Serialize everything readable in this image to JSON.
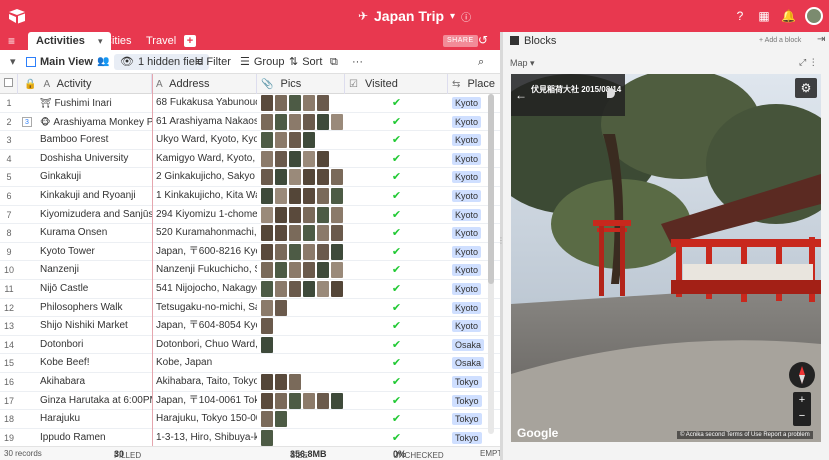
{
  "app": {
    "title": "Japan Trip",
    "share_label": "SHARE"
  },
  "tabs": [
    {
      "label": "Activities"
    },
    {
      "label": "Cities"
    },
    {
      "label": "Travel"
    }
  ],
  "toolbar": {
    "view_name": "Main View",
    "hidden_fields": "1 hidden field",
    "filter": "Filter",
    "group": "Group",
    "sort": "Sort"
  },
  "columns": [
    {
      "label": "Activity",
      "icon": "text-icon"
    },
    {
      "label": "Address",
      "icon": "text-icon"
    },
    {
      "label": "Pics",
      "icon": "attachment-icon"
    },
    {
      "label": "Visited",
      "icon": "checkbox-icon"
    },
    {
      "label": "Place",
      "icon": "link-icon"
    }
  ],
  "rows": [
    {
      "num": "1",
      "activity": "Fushimi Inari",
      "icon": "⛩",
      "address": "68 Fukakusa Yabunouchi...",
      "pics": 5,
      "visited": true,
      "place": "Kyoto"
    },
    {
      "num": "2",
      "activity": "Arashiyama Monkey Park",
      "icon": "🐵",
      "address": "61 Arashiyama Nakaoshit...",
      "pics": 6,
      "visited": true,
      "place": "Kyoto",
      "expand": "3"
    },
    {
      "num": "3",
      "activity": "Bamboo Forest",
      "icon": "",
      "address": "Ukyo Ward, Kyoto, Kyoto...",
      "pics": 4,
      "visited": true,
      "place": "Kyoto"
    },
    {
      "num": "4",
      "activity": "Doshisha University",
      "icon": "",
      "address": "Kamigyo Ward, Kyoto, K...",
      "pics": 5,
      "visited": true,
      "place": "Kyoto"
    },
    {
      "num": "5",
      "activity": "Ginkakuji",
      "icon": "",
      "address": "2 Ginkakujicho, Sakyo W...",
      "pics": 6,
      "visited": true,
      "place": "Kyoto"
    },
    {
      "num": "6",
      "activity": "Kinkakuji and Ryoanji",
      "icon": "",
      "address": "1 Kinkakujicho, Kita Ward...",
      "pics": 6,
      "visited": true,
      "place": "Kyoto"
    },
    {
      "num": "7",
      "activity": "Kiyomizudera and Sanjūsan...",
      "icon": "",
      "address": "294 Kiyomizu 1-chome, ...",
      "pics": 6,
      "visited": true,
      "place": "Kyoto"
    },
    {
      "num": "8",
      "activity": "Kurama Onsen",
      "icon": "",
      "address": "520 Kuramahonmachi, Sa...",
      "pics": 6,
      "visited": true,
      "place": "Kyoto"
    },
    {
      "num": "9",
      "activity": "Kyoto Tower",
      "icon": "",
      "address": "Japan, 〒600-8216 Kyoto...",
      "pics": 6,
      "visited": true,
      "place": "Kyoto"
    },
    {
      "num": "10",
      "activity": "Nanzenji",
      "icon": "",
      "address": "Nanzenji Fukuchicho, Sa...",
      "pics": 6,
      "visited": true,
      "place": "Kyoto"
    },
    {
      "num": "11",
      "activity": "Nijō Castle",
      "icon": "",
      "address": "541 Nijojocho, Nakagyo ...",
      "pics": 6,
      "visited": true,
      "place": "Kyoto"
    },
    {
      "num": "12",
      "activity": "Philosophers Walk",
      "icon": "",
      "address": "Tetsugaku-no-michi, Sak...",
      "pics": 2,
      "visited": true,
      "place": "Kyoto"
    },
    {
      "num": "13",
      "activity": "Shijo Nishiki Market",
      "icon": "",
      "address": "Japan, 〒604-8054 Kyoto...",
      "pics": 1,
      "visited": true,
      "place": "Kyoto"
    },
    {
      "num": "14",
      "activity": "Dotonbori",
      "icon": "",
      "address": "Dotonbori, Chuo Ward, O...",
      "pics": 1,
      "visited": true,
      "place": "Osaka"
    },
    {
      "num": "15",
      "activity": "Kobe Beef!",
      "icon": "",
      "address": "Kobe, Japan",
      "pics": 0,
      "visited": true,
      "place": "Osaka"
    },
    {
      "num": "16",
      "activity": "Akihabara",
      "icon": "",
      "address": "Akihabara, Taito, Tokyo 1...",
      "pics": 3,
      "visited": true,
      "place": "Tokyo"
    },
    {
      "num": "17",
      "activity": "Ginza Harutaka at 6:00PM-...",
      "icon": "",
      "address": "Japan, 〒104-0061 Tokyo...",
      "pics": 6,
      "visited": true,
      "place": "Tokyo"
    },
    {
      "num": "18",
      "activity": "Harajuku",
      "icon": "",
      "address": "Harajuku, Tokyo 150-00...",
      "pics": 2,
      "visited": true,
      "place": "Tokyo"
    },
    {
      "num": "19",
      "activity": "Ippudo Ramen",
      "icon": "",
      "address": "1-3-13, Hiro, Shibuya-ku,...",
      "pics": 1,
      "visited": true,
      "place": "Tokyo"
    }
  ],
  "footer": {
    "records": "30 records",
    "filled_label": "FILLED",
    "filled_value": "30",
    "size_label": "SIZE",
    "size_value": "356.8MB",
    "unchecked_label": "UNCHECKED",
    "unchecked_value": "0%",
    "empty_label": "EMPT"
  },
  "blocks": {
    "title": "Blocks",
    "add_block": "+ Add a block",
    "map_label": "Map",
    "streetview_title": "伏見稲荷大社 2015/08/14",
    "google": "Google",
    "attribution": "© Acnika second   Terms of Use   Report a problem"
  },
  "colors": {
    "brand": "#e8384f",
    "check": "#20c933",
    "place_tag": "#cfdfff"
  }
}
